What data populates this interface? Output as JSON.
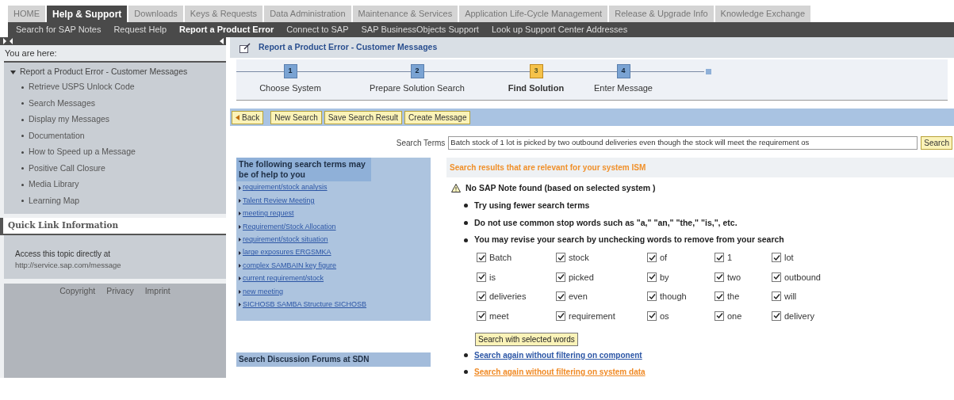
{
  "top_tabs": [
    {
      "label": "HOME",
      "selected": false
    },
    {
      "label": "Help & Support",
      "selected": true
    },
    {
      "label": "Downloads",
      "selected": false
    },
    {
      "label": "Keys & Requests",
      "selected": false
    },
    {
      "label": "Data Administration",
      "selected": false
    },
    {
      "label": "Maintenance & Services",
      "selected": false
    },
    {
      "label": "Application Life-Cycle Management",
      "selected": false
    },
    {
      "label": "Release & Upgrade Info",
      "selected": false
    },
    {
      "label": "Knowledge Exchange",
      "selected": false
    }
  ],
  "sub_nav": [
    {
      "label": "Search for SAP Notes",
      "selected": false
    },
    {
      "label": "Request Help",
      "selected": false
    },
    {
      "label": "Report a Product Error",
      "selected": true
    },
    {
      "label": "Connect to SAP",
      "selected": false
    },
    {
      "label": "SAP BusinessObjects Support",
      "selected": false
    },
    {
      "label": "Look up Support Center Addresses",
      "selected": false
    }
  ],
  "sidebar": {
    "breadcrumb_title": "You are here:",
    "tree": [
      {
        "label": "Report a Product Error - Customer Messages",
        "expanded": true,
        "children": [
          {
            "label": "Retrieve USPS Unlock Code"
          },
          {
            "label": "Search Messages"
          },
          {
            "label": "Display my Messages"
          },
          {
            "label": "Documentation"
          },
          {
            "label": "How to Speed up a Message"
          },
          {
            "label": "Positive Call Closure"
          },
          {
            "label": "Media Library"
          },
          {
            "label": "Learning Map"
          }
        ]
      }
    ],
    "quick_link": {
      "title": "Quick Link Information",
      "text": "Access this topic directly at",
      "url": "http://service.sap.com/message"
    },
    "footer_links": [
      "Copyright",
      "Privacy",
      "Imprint"
    ]
  },
  "page_title": "Report a Product Error - Customer Messages",
  "steps": [
    {
      "number": "1",
      "label": "Choose System",
      "selected": false
    },
    {
      "number": "2",
      "label": "Prepare Solution Search",
      "selected": false
    },
    {
      "number": "3",
      "label": "Find Solution",
      "selected": true
    },
    {
      "number": "4",
      "label": "Enter Message",
      "selected": false
    }
  ],
  "toolbar": {
    "back": "Back",
    "buttons": [
      "New Search",
      "Save Search Result",
      "Create Message"
    ]
  },
  "search": {
    "label": "Search Terms",
    "value": "Batch stock of 1 lot is picked by two outbound deliveries even though the stock will meet the requirement os",
    "button": "Search"
  },
  "suggestions": {
    "title": "The following search terms may be of help to you",
    "links": [
      "requirement/stock analysis",
      "Talent Review Meeting",
      "meeting request",
      "Requirement/Stock Allocation",
      "requirement/stock situation",
      "large exposures ERGSMKA",
      "complex SAMBAIN key figure",
      "current requirement/stock",
      "new meeting",
      "SICHOSB SAMBA Structure SICHOSB"
    ],
    "forums_title": "Search Discussion Forums at SDN"
  },
  "results": {
    "title": "Search results that are relevant for your system ISM",
    "warning": "No SAP Note found  (based on selected system )",
    "tips": [
      "Try using fewer search terms",
      "Do not use common stop words such as \"a,\" \"an,\" \"the,\" \"is,\", etc.",
      "You may revise your search by unchecking words to remove from your search"
    ],
    "words": [
      {
        "label": "Batch",
        "checked": true
      },
      {
        "label": "stock",
        "checked": true
      },
      {
        "label": "of",
        "checked": true
      },
      {
        "label": "1",
        "checked": true
      },
      {
        "label": "lot",
        "checked": true
      },
      {
        "label": "is",
        "checked": true
      },
      {
        "label": "picked",
        "checked": true
      },
      {
        "label": "by",
        "checked": true
      },
      {
        "label": "two",
        "checked": true
      },
      {
        "label": "outbound",
        "checked": true
      },
      {
        "label": "deliveries",
        "checked": true
      },
      {
        "label": "even",
        "checked": true
      },
      {
        "label": "though",
        "checked": true
      },
      {
        "label": "the",
        "checked": true
      },
      {
        "label": "will",
        "checked": true
      },
      {
        "label": "meet",
        "checked": true
      },
      {
        "label": "requirement",
        "checked": true
      },
      {
        "label": "os",
        "checked": true
      },
      {
        "label": "one",
        "checked": true
      },
      {
        "label": "delivery",
        "checked": true
      }
    ],
    "search_selected": "Search with selected words",
    "links": [
      {
        "label": "Search again without filtering on component",
        "kind": "blue"
      },
      {
        "label": "Search again without filtering on system data",
        "kind": "orange"
      }
    ]
  }
}
